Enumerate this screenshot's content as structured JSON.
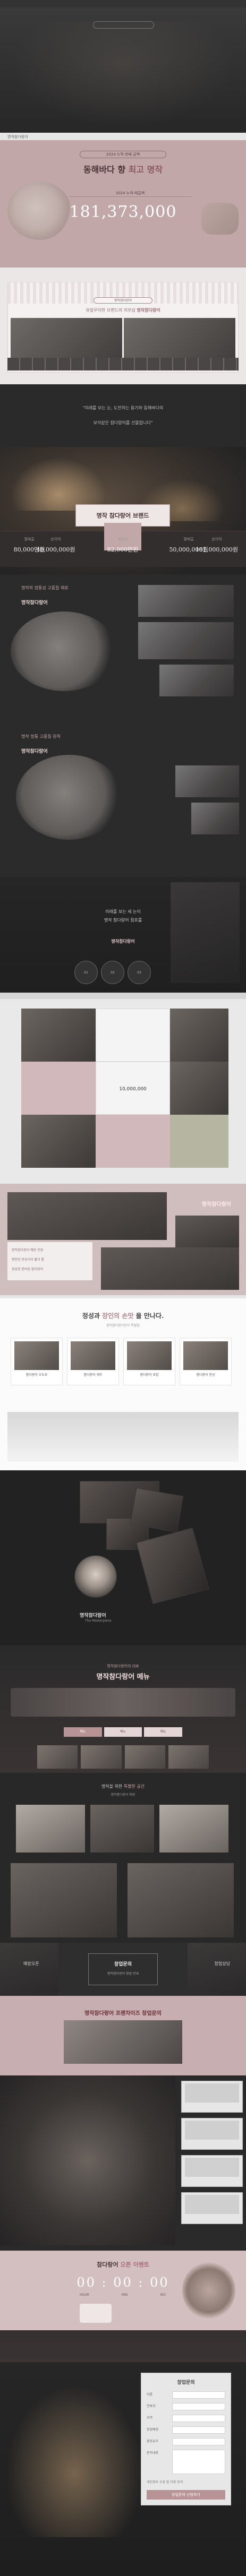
{
  "nav": {
    "brand": "명작참다랑어"
  },
  "count": {
    "badge": "2024 누적 판매 금액",
    "headline_a": "동해바다 향",
    "headline_hl": "최고 명작",
    "headline_b": "",
    "sub_label": "2024 누적 매출액",
    "number": "181,373,000"
  },
  "banner": {
    "tag": "명작참다랑어",
    "line_a": "유일무이한 브랜드의 자부심",
    "line_hl": "명작참다랑어"
  },
  "quote": {
    "line1": "\"미래를 보는 눈, 도전하는 용기와 동해바다의",
    "line2": "보석같은 참다랑어를 선물합니다\""
  },
  "fire": {
    "title": "명작 참다랑어 브랜드",
    "stats": [
      {
        "k": "월매출",
        "v": "80,000만원"
      },
      {
        "k": "순이익",
        "v": "40,000,000원"
      },
      {
        "k": "매장수",
        "v": "82,000만원"
      },
      {
        "k": "월매출",
        "v": "50,000,000원"
      },
      {
        "k": "순이익",
        "v": "181,000,000원"
      }
    ]
  },
  "story": [
    {
      "label": "명작의 정통성 고품질 재료",
      "name": "명작참다랑어"
    },
    {
      "label": "명작 정통 고품질 원칙",
      "name": "명작참다랑어"
    }
  ],
  "poster": {
    "line1": "미래를 보는 세 눈이",
    "line2": "명작 참다랑어 점포를",
    "line3": "명작참다랑어",
    "circles": [
      "01",
      "02",
      "03"
    ]
  },
  "grid": {
    "caption": "10,000,000"
  },
  "store": {
    "title": "명작참다랑어",
    "lines": [
      "명작참다랑어 매장 전경",
      "편안한 분위기의 홀과 룸",
      "정성껏 준비된 참다랑어"
    ]
  },
  "why": {
    "h_a": "정성과",
    "h_hl": "장인의 손맛",
    "h_b": "을 만나다.",
    "sub": "명작참다랑어만의 특별함",
    "cards": [
      "참다랑어 오도로",
      "참다랑어 세트",
      "참다랑어 초밥",
      "참다랑어 한상"
    ]
  },
  "dark": {
    "name": "명작참다랑어",
    "sub": "The Masterpiece"
  },
  "menu": {
    "cap": "명작참다랑어의 대표",
    "title": "명작참다랑어 메뉴",
    "tabs": [
      "메뉴",
      "메뉴",
      "메뉴"
    ],
    "active_tab": 0
  },
  "interior": {
    "cap_a": "명작을 위한",
    "cap_hl": "특별한 공간",
    "cap_b": "",
    "cap2": "명작참다랑어 매장"
  },
  "cta": {
    "box_title": "창업문의",
    "box_sub": "명작참다랑어 창업 안내",
    "left": "매장오픈",
    "right": "창업상담",
    "big": "명작참다랑어 프랜차이즈 창업문의"
  },
  "timer": {
    "title_a": "참다랑어",
    "title_hl": "오픈 이벤트",
    "title_b": "",
    "clock": "00 : 00 : 00",
    "units": [
      "HOUR",
      "MIN",
      "SEC"
    ]
  },
  "form": {
    "title": "창업문의",
    "fields": [
      {
        "label": "이름",
        "placeholder": ""
      },
      {
        "label": "연락처",
        "placeholder": ""
      },
      {
        "label": "지역",
        "placeholder": ""
      },
      {
        "label": "창업예정",
        "placeholder": ""
      },
      {
        "label": "점포유무",
        "placeholder": ""
      },
      {
        "label": "문의내용",
        "placeholder": ""
      }
    ],
    "agree": "개인정보 수집 및 이용 동의",
    "submit": "창업문의 신청하기"
  },
  "colors": {
    "pink": "#c2a7a9",
    "accent": "#b89396",
    "dark": "#262626"
  }
}
